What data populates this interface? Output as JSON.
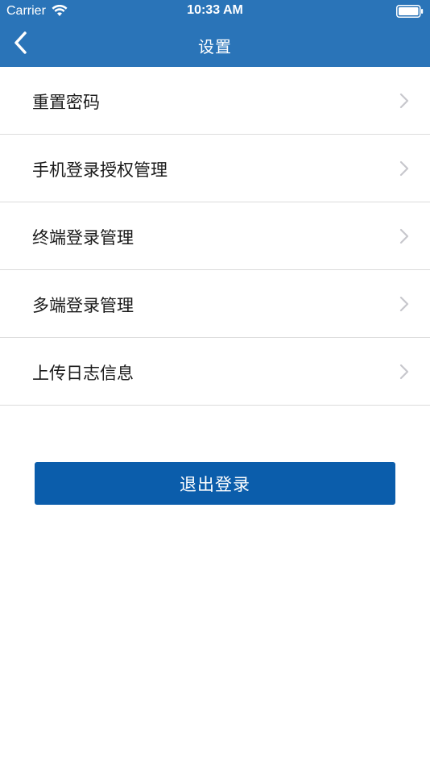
{
  "status_bar": {
    "carrier": "Carrier",
    "time": "10:33 AM"
  },
  "nav": {
    "title": "设置",
    "back_icon": "chevron-left-icon"
  },
  "settings": {
    "items": [
      {
        "label": "重置密码"
      },
      {
        "label": "手机登录授权管理"
      },
      {
        "label": "终端登录管理"
      },
      {
        "label": "多端登录管理"
      },
      {
        "label": "上传日志信息"
      }
    ]
  },
  "logout": {
    "label": "退出登录"
  },
  "colors": {
    "header_bg": "#2a74b8",
    "button_bg": "#0b5dab",
    "divider": "#dcdcdc",
    "chevron": "#c7c7cc"
  }
}
